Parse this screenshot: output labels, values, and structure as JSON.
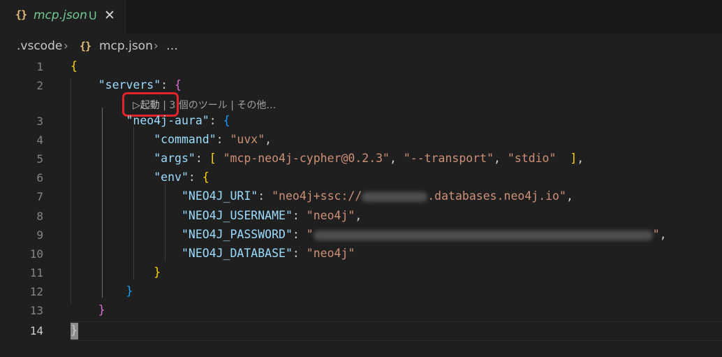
{
  "tab": {
    "icon": "{}",
    "title": "mcp.json",
    "status": "U",
    "close": "✕"
  },
  "breadcrumb": {
    "folder": ".vscode",
    "separator": "›",
    "file_icon": "{}",
    "file": "mcp.json",
    "more": "…"
  },
  "codelens": {
    "run_label": "▷起動",
    "divider": "|",
    "tools": "3 個のツール",
    "more": "その他…"
  },
  "line_numbers": [
    "1",
    "2",
    "3",
    "4",
    "5",
    "6",
    "7",
    "8",
    "9",
    "10",
    "11",
    "12",
    "13",
    "14"
  ],
  "code": {
    "servers_key": "\"servers\"",
    "server_name": "\"neo4j-aura\"",
    "command_key": "\"command\"",
    "command_val": "\"uvx\"",
    "args_key": "\"args\"",
    "arg1": "\"mcp-neo4j-cypher@0.2.3\"",
    "arg2": "\"--transport\"",
    "arg3": "\"stdio\"",
    "env_key": "\"env\"",
    "uri_key": "\"NEO4J_URI\"",
    "uri_prefix": "\"neo4j+ssc://",
    "uri_suffix": ".databases.neo4j.io\"",
    "username_key": "\"NEO4J_USERNAME\"",
    "username_val": "\"neo4j\"",
    "password_key": "\"NEO4J_PASSWORD\"",
    "password_open": "\"",
    "password_close": "\"",
    "database_key": "\"NEO4J_DATABASE\"",
    "database_val": "\"neo4j\""
  },
  "colors": {
    "key": "#9cdcfe",
    "string": "#ce9178",
    "bracket_level1": "#ffd700",
    "bracket_level2": "#da70d6",
    "bracket_level3": "#179fff",
    "highlight_box": "#e3242b",
    "untracked": "#73c991"
  }
}
